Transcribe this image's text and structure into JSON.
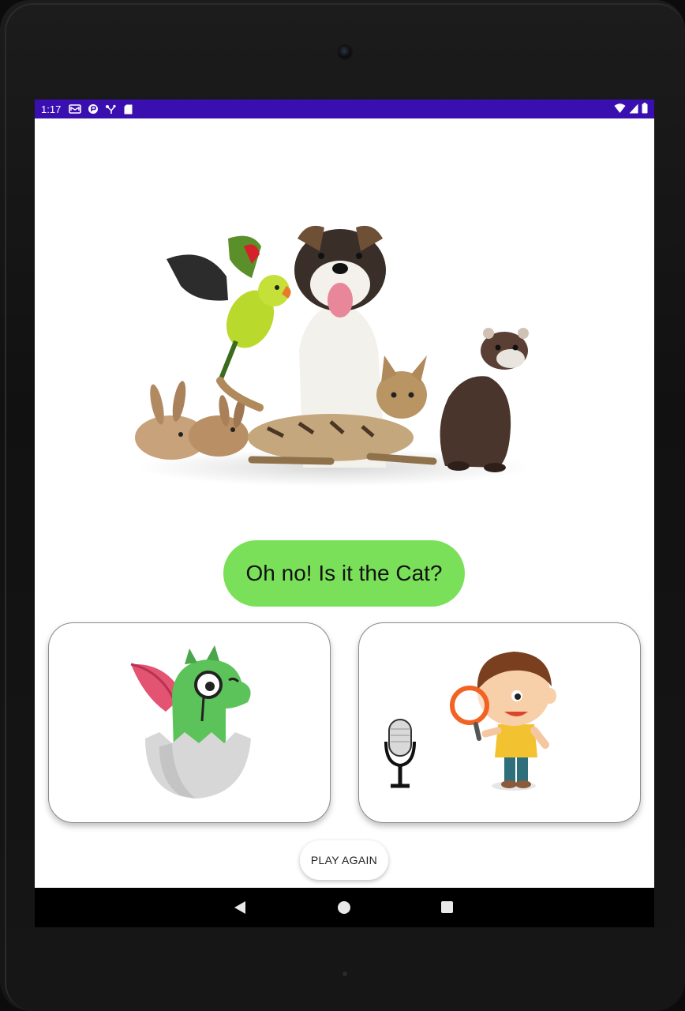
{
  "status_bar": {
    "time": "1:17",
    "left_icons": [
      "mail-icon",
      "sync-icon",
      "network-icon",
      "sd-card-icon"
    ],
    "right_icons": [
      "wifi-icon",
      "signal-icon",
      "battery-icon"
    ],
    "color": "#3a0fb0"
  },
  "hero_image": {
    "icon": "pets-group-image"
  },
  "speech_bubble": {
    "text": "Oh no! Is it the Cat?",
    "color": "#7ae05a"
  },
  "cards": [
    {
      "icon": "dragon-detective-icon"
    },
    {
      "icons": [
        "microphone-icon",
        "boy-magnifier-icon"
      ]
    }
  ],
  "play_again": {
    "label": "PLAY AGAIN"
  },
  "nav_bar": {
    "icons": [
      "back-icon",
      "home-icon",
      "recents-icon"
    ]
  }
}
